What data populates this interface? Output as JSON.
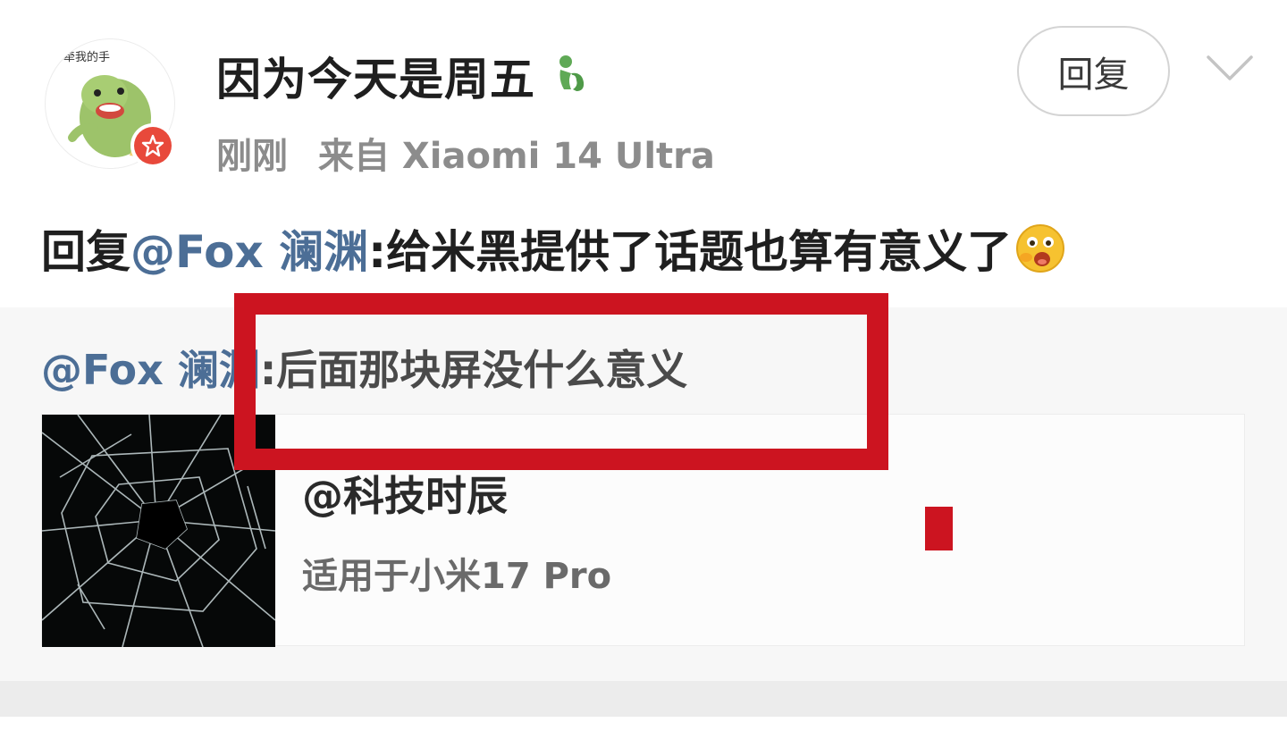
{
  "header": {
    "avatar_text": "牵我的手",
    "username": "因为今天是周五",
    "user_badge_icon": "green-figure-icon",
    "time": "刚刚",
    "source": "来自 Xiaomi 14 Ultra",
    "reply_button_label": "回复",
    "expand_icon": "chevron-down-icon"
  },
  "comment": {
    "prefix": "回复",
    "mention": "@Fox 澜渊",
    "text": ":给米黑提供了话题也算有意义了",
    "emoji": "surprised-emoji"
  },
  "quote": {
    "mention": "@Fox 澜渊",
    "text": ":后面那块屏没什么意义"
  },
  "link_card": {
    "title": "@科技时辰",
    "subtitle": "适用于小米17 Pro",
    "thumbnail": "cracked-glass-image"
  },
  "colors": {
    "mention": "#4c6e96",
    "annotation": "#cc1420",
    "verified": "#e8493b"
  }
}
